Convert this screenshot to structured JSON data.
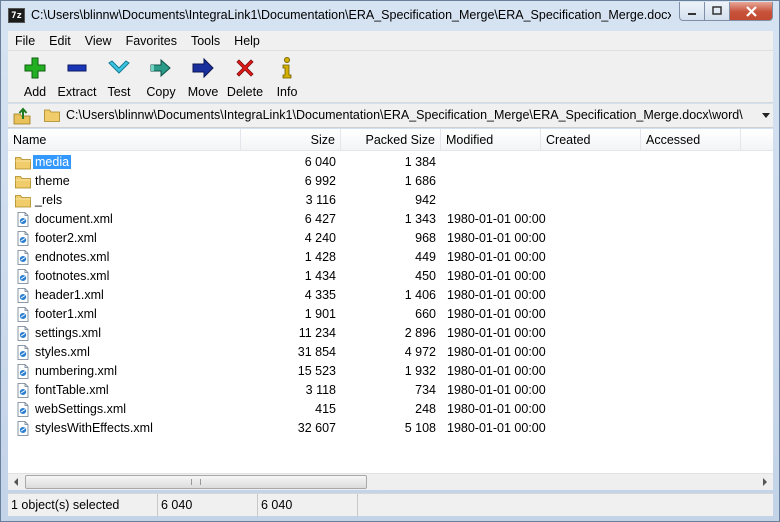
{
  "window": {
    "title": "C:\\Users\\blinnw\\Documents\\IntegraLink1\\Documentation\\ERA_Specification_Merge\\ERA_Specification_Merge.docx\\wo...",
    "app_icon_text": "7z"
  },
  "menu": [
    "File",
    "Edit",
    "View",
    "Favorites",
    "Tools",
    "Help"
  ],
  "toolbar": [
    {
      "label": "Add",
      "icon": "plus-icon",
      "color": "#22a822"
    },
    {
      "label": "Extract",
      "icon": "minus-icon",
      "color": "#1a35b5"
    },
    {
      "label": "Test",
      "icon": "check-icon",
      "color": "#25a9c9"
    },
    {
      "label": "Copy",
      "icon": "copy-arrow-icon",
      "color": "#1f8a7a"
    },
    {
      "label": "Move",
      "icon": "move-arrow-icon",
      "color": "#1a2f9e"
    },
    {
      "label": "Delete",
      "icon": "delete-x-icon",
      "color": "#e01818"
    },
    {
      "label": "Info",
      "icon": "info-icon",
      "color": "#c9a800"
    }
  ],
  "address": {
    "path": "C:\\Users\\blinnw\\Documents\\IntegraLink1\\Documentation\\ERA_Specification_Merge\\ERA_Specification_Merge.docx\\word\\"
  },
  "columns": [
    "Name",
    "Size",
    "Packed Size",
    "Modified",
    "Created",
    "Accessed"
  ],
  "files": [
    {
      "name": "media",
      "type": "folder",
      "size": "6 040",
      "packed": "1 384",
      "modified": "",
      "selected": true
    },
    {
      "name": "theme",
      "type": "folder",
      "size": "6 992",
      "packed": "1 686",
      "modified": ""
    },
    {
      "name": "_rels",
      "type": "folder",
      "size": "3 116",
      "packed": "942",
      "modified": ""
    },
    {
      "name": "document.xml",
      "type": "file",
      "size": "6 427",
      "packed": "1 343",
      "modified": "1980-01-01 00:00"
    },
    {
      "name": "footer2.xml",
      "type": "file",
      "size": "4 240",
      "packed": "968",
      "modified": "1980-01-01 00:00"
    },
    {
      "name": "endnotes.xml",
      "type": "file",
      "size": "1 428",
      "packed": "449",
      "modified": "1980-01-01 00:00"
    },
    {
      "name": "footnotes.xml",
      "type": "file",
      "size": "1 434",
      "packed": "450",
      "modified": "1980-01-01 00:00"
    },
    {
      "name": "header1.xml",
      "type": "file",
      "size": "4 335",
      "packed": "1 406",
      "modified": "1980-01-01 00:00"
    },
    {
      "name": "footer1.xml",
      "type": "file",
      "size": "1 901",
      "packed": "660",
      "modified": "1980-01-01 00:00"
    },
    {
      "name": "settings.xml",
      "type": "file",
      "size": "11 234",
      "packed": "2 896",
      "modified": "1980-01-01 00:00"
    },
    {
      "name": "styles.xml",
      "type": "file",
      "size": "31 854",
      "packed": "4 972",
      "modified": "1980-01-01 00:00"
    },
    {
      "name": "numbering.xml",
      "type": "file",
      "size": "15 523",
      "packed": "1 932",
      "modified": "1980-01-01 00:00"
    },
    {
      "name": "fontTable.xml",
      "type": "file",
      "size": "3 118",
      "packed": "734",
      "modified": "1980-01-01 00:00"
    },
    {
      "name": "webSettings.xml",
      "type": "file",
      "size": "415",
      "packed": "248",
      "modified": "1980-01-01 00:00"
    },
    {
      "name": "stylesWithEffects.xml",
      "type": "file",
      "size": "32 607",
      "packed": "5 108",
      "modified": "1980-01-01 00:00"
    }
  ],
  "status": {
    "selection": "1 object(s) selected",
    "size": "6 040",
    "packed": "6 040"
  }
}
